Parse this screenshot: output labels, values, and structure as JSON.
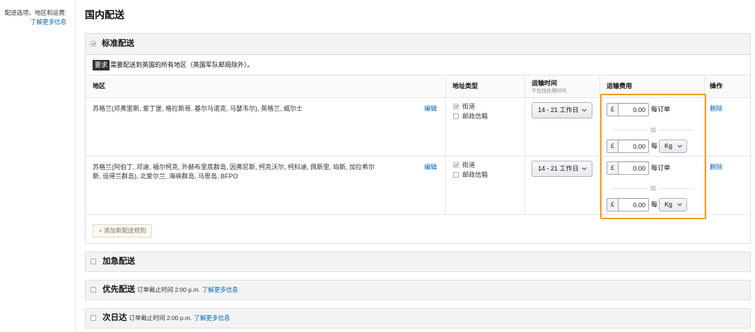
{
  "sidebar": {
    "label": "配送选项、地区和运费:",
    "learn_more": "了解更多信息"
  },
  "page_title": "国内配送",
  "standard": {
    "title": "标准配送",
    "checked": true,
    "requirement": {
      "badge": "要求",
      "text": "需要配送到英国的所有地区（英国军队邮局除外）。"
    },
    "columns": {
      "region": "地区",
      "address_type": "地址类型",
      "transit_time": "运输时间",
      "transit_time_note": "不包括处理时间",
      "shipping_fee": "运输费用",
      "actions": "操作"
    },
    "rows": [
      {
        "region": "苏格兰(邓弗里斯, 爱丁堡, 格拉斯哥, 基尔马诺克, 马瑟韦尔), 英格兰, 威尔士",
        "edit": "编辑",
        "address_types": [
          {
            "label": "街道",
            "checked": true
          },
          {
            "label": "邮政信箱",
            "checked": false
          }
        ],
        "transit_time": "14 - 21 工作日",
        "fee": {
          "currency": "£",
          "per_order_amount": "0.00",
          "per_order_label": "每订单",
          "plus": "加",
          "per_unit_amount": "0.00",
          "per_unit_label": "每",
          "unit": "Kg"
        },
        "delete": "删除"
      },
      {
        "region": "苏格兰(阿伯丁, 邓迪, 福尔柯克, 外赫布里底群岛, 因弗尼斯, 柯克沃尔, 柯科迪, 佩斯里, 珀斯, 加拉希尔斯, 设得兰群岛), 北爱尔兰, 海峡群岛, 马恩岛, BFPO",
        "edit": "编辑",
        "address_types": [
          {
            "label": "街道",
            "checked": true
          },
          {
            "label": "邮政信箱",
            "checked": false
          }
        ],
        "transit_time": "14 - 21 工作日",
        "fee": {
          "currency": "£",
          "per_order_amount": "0.00",
          "per_order_label": "每订单",
          "plus": "加",
          "per_unit_amount": "0.00",
          "per_unit_label": "每",
          "unit": "Kg"
        },
        "delete": "删除"
      }
    ],
    "add_rule": "+ 添加新配送规则"
  },
  "other_options": [
    {
      "title": "加急配送",
      "checked": false
    },
    {
      "title": "优先配送",
      "checked": false,
      "note": "订单截止时间 2:00 p.m.",
      "link": "了解更多信息"
    },
    {
      "title": "次日达",
      "checked": false,
      "note": "订单截止时间 2:00 p.m.",
      "link": "了解更多信息"
    }
  ],
  "icons": {
    "checkbox": "checkbox-icon",
    "checkmark": "checkmark-icon",
    "dropdown": "chevron-down-icon"
  },
  "colors": {
    "highlight": "#f39c1d",
    "link": "#0066c0",
    "badge_bg": "#333333"
  }
}
